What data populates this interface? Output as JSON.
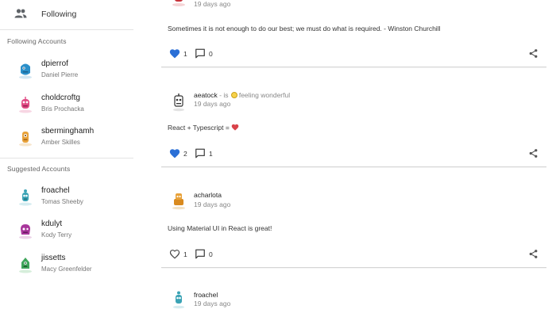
{
  "sidebar": {
    "following_label": "Following",
    "following_accounts_title": "Following Accounts",
    "following_accounts": [
      {
        "username": "dpierrof",
        "name": "Daniel Pierre",
        "avatar_color": "#2b8fc9"
      },
      {
        "username": "choldcroftg",
        "name": "Bris Prochacka",
        "avatar_color": "#e04b84"
      },
      {
        "username": "sberminghamh",
        "name": "Amber Skilles",
        "avatar_color": "#e8a23a"
      }
    ],
    "suggested_accounts_title": "Suggested Accounts",
    "suggested_accounts": [
      {
        "username": "froachel",
        "name": "Tomas Sheeby",
        "avatar_color": "#3aa3b5"
      },
      {
        "username": "kdulyt",
        "name": "Kody Terry",
        "avatar_color": "#a8369b"
      },
      {
        "username": "jissetts",
        "name": "Macy Greenfelder",
        "avatar_color": "#3fa55b"
      }
    ]
  },
  "feed": {
    "posts": [
      {
        "time": "19 days ago",
        "text": "Sometimes it is not enough to do our best; we must do what is required. - Winston Churchill",
        "liked": true,
        "likes": "1",
        "comments": "0"
      },
      {
        "username": "aeatock",
        "feeling_prefix": " - is ",
        "feeling": "feeling wonderful",
        "time": "19 days ago",
        "text": "React + Typescript =",
        "liked": true,
        "likes": "2",
        "comments": "1"
      },
      {
        "username": "acharlota",
        "time": "19 days ago",
        "text": "Using Material UI in React is great!",
        "liked": false,
        "likes": "1",
        "comments": "0"
      },
      {
        "username": "froachel",
        "time": "19 days ago"
      }
    ]
  },
  "colors": {
    "like_blue": "#2a6fd6",
    "heart_red": "#d9434a",
    "icon_gray": "#555555"
  }
}
